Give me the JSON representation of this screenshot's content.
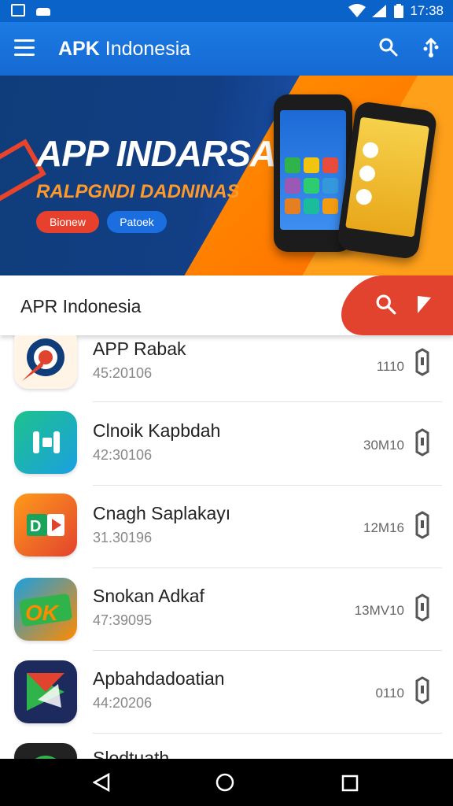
{
  "status_bar": {
    "time": "17:38"
  },
  "app_bar": {
    "title_bold": "APK",
    "title_rest": " Indonesia"
  },
  "banner": {
    "headline": "APP INDARSAI",
    "subline": "RALPGNDI DADNINAS",
    "button_primary": "Bionew",
    "button_secondary": "Patoek"
  },
  "search_card": {
    "label": "APR Indonesia"
  },
  "apps": [
    {
      "name": "APP Rabak",
      "meta": "45:20106",
      "size": "1110"
    },
    {
      "name": "Clnoik Kapbdah",
      "meta": "42:30106",
      "size": "30M10"
    },
    {
      "name": "Cnagh Saplakayı",
      "meta": "31.30196",
      "size": "12M16"
    },
    {
      "name": "Snokan Adkaf",
      "meta": "47:39095",
      "size": "13MV10"
    },
    {
      "name": "Apbahdadoatian",
      "meta": "44:20206",
      "size": "0110"
    },
    {
      "name": "Slodtuath",
      "meta": "",
      "size": ""
    }
  ],
  "colors": {
    "primary_blue": "#1669d2",
    "accent_red": "#e2432f",
    "accent_orange": "#ff8a00"
  }
}
